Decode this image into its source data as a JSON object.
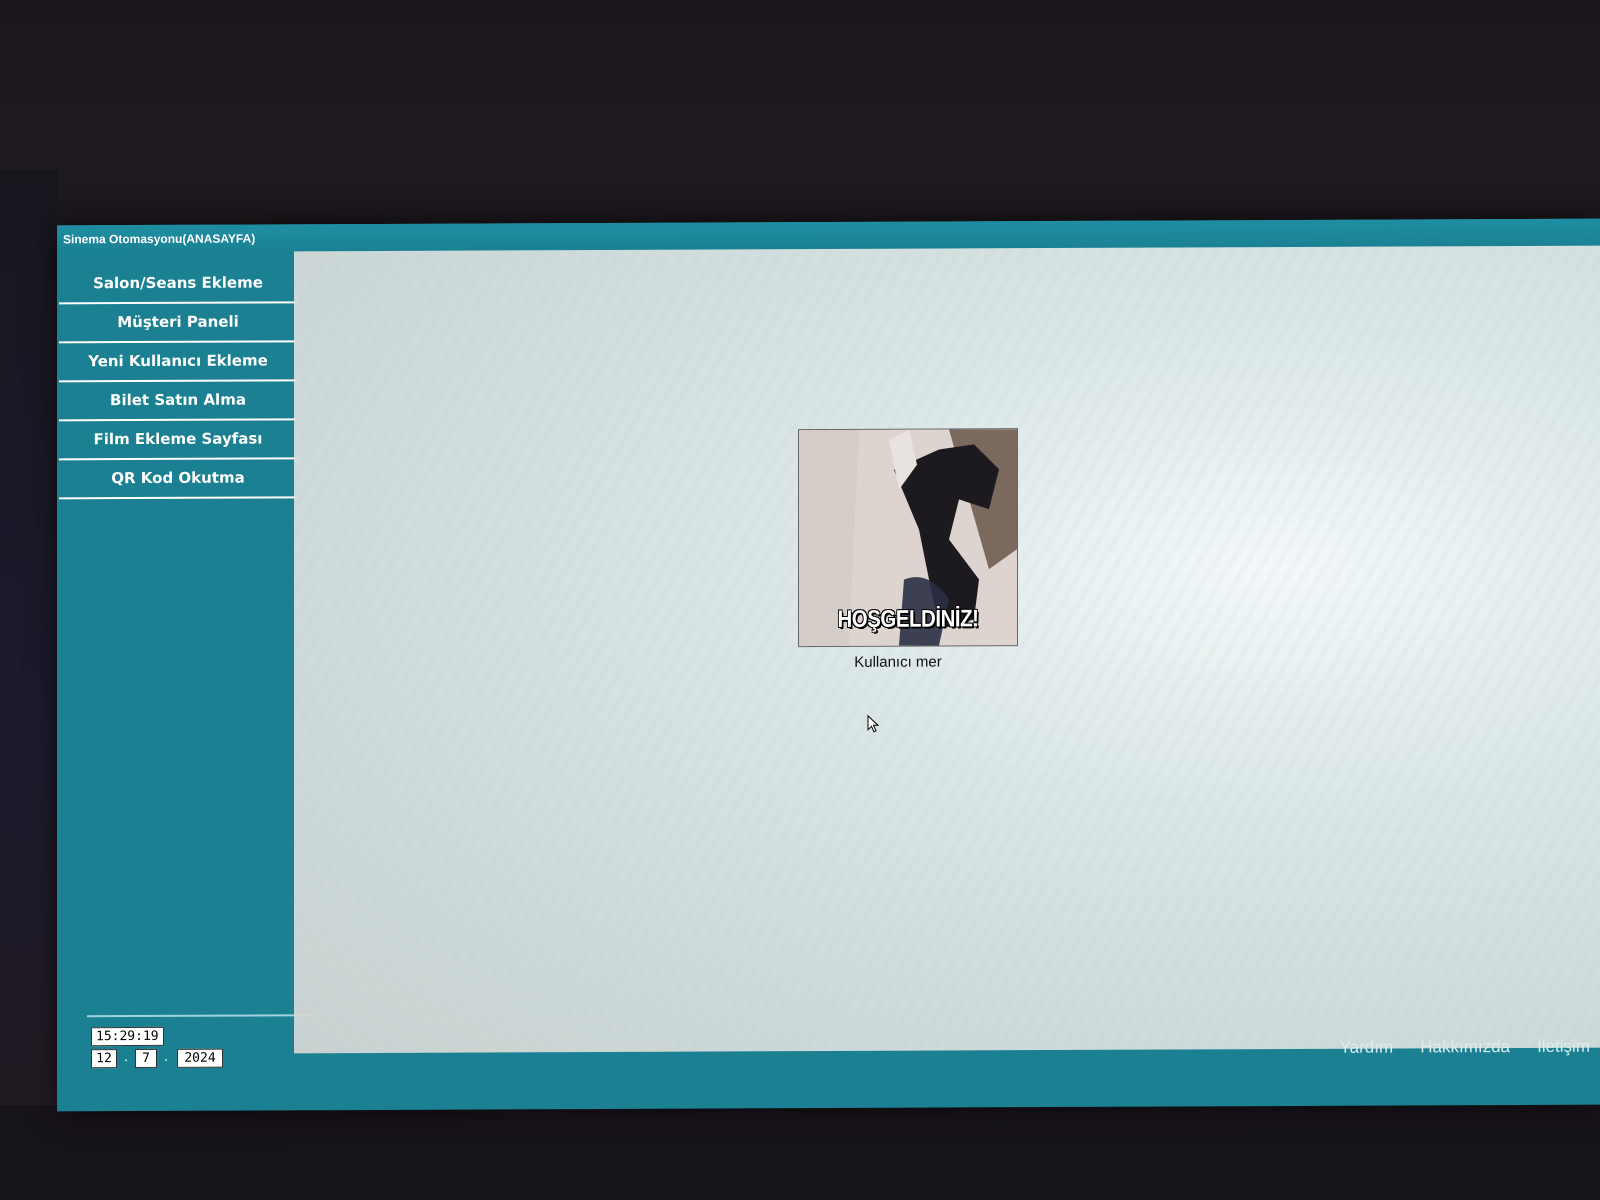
{
  "window": {
    "title": "Sinema Otomasyonu(ANASAYFA)"
  },
  "sidebar": {
    "items": [
      {
        "label": "Salon/Seans Ekleme"
      },
      {
        "label": "Müşteri Paneli"
      },
      {
        "label": "Yeni Kullanıcı Ekleme"
      },
      {
        "label": "Bilet Satın Alma"
      },
      {
        "label": "Film Ekleme Sayfası"
      },
      {
        "label": "QR Kod Okutma"
      }
    ]
  },
  "clock": {
    "time": "15:29:19",
    "day": "12",
    "month": "7",
    "year": "2024",
    "separator": "."
  },
  "main": {
    "welcome_caption": "HOŞGELDİNİZ!",
    "user_label": "Kullanıcı mer"
  },
  "footer": {
    "help": "Yardım",
    "about": "Hakkımızda",
    "contact": "İletişim"
  },
  "colors": {
    "accent": "#1a8092",
    "content_background": "#eef0ee",
    "menu_text": "#ffffff"
  }
}
